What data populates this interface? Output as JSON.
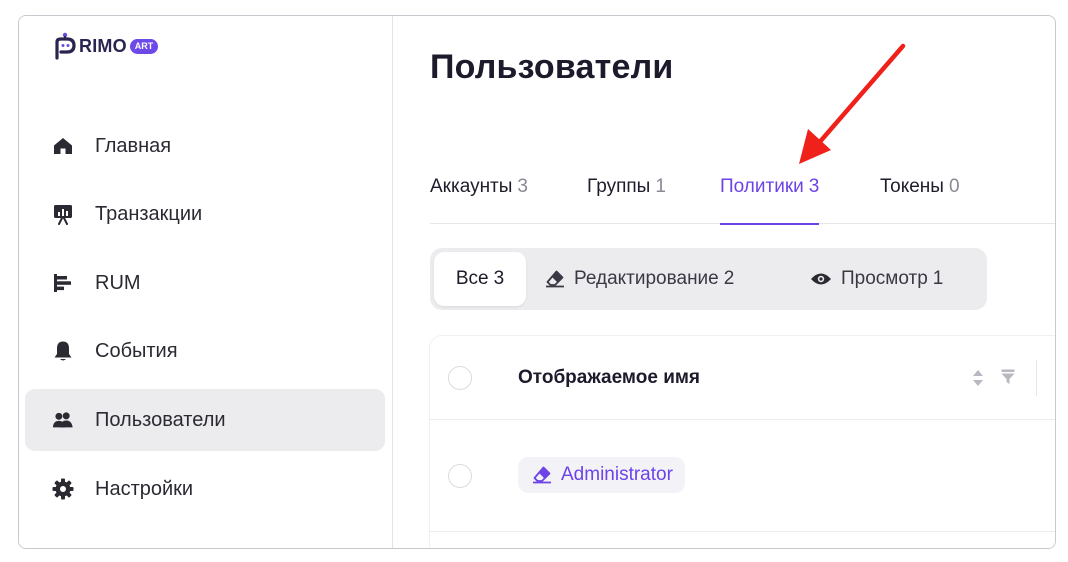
{
  "brand": {
    "logo_text": "RIMO",
    "logo_badge": "ART",
    "accent": "#6c43e6"
  },
  "sidebar": {
    "items": [
      {
        "label": "Главная",
        "icon": "home-icon"
      },
      {
        "label": "Транзакции",
        "icon": "presentation-icon"
      },
      {
        "label": "RUM",
        "icon": "bar-chart-icon"
      },
      {
        "label": "События",
        "icon": "bell-icon"
      },
      {
        "label": "Пользователи",
        "icon": "users-icon",
        "active": true
      },
      {
        "label": "Настройки",
        "icon": "gear-icon"
      }
    ]
  },
  "main": {
    "title": "Пользователи",
    "tabs": [
      {
        "label": "Аккаунты",
        "count": "3"
      },
      {
        "label": "Группы",
        "count": "1"
      },
      {
        "label": "Политики",
        "count": "3",
        "active": true
      },
      {
        "label": "Токены",
        "count": "0"
      }
    ],
    "filters": [
      {
        "label": "Все",
        "count": "3",
        "active": true
      },
      {
        "label": "Редактирование",
        "count": "2",
        "icon": "eraser-icon"
      },
      {
        "label": "Просмотр",
        "count": "1",
        "icon": "eye-icon"
      }
    ],
    "table": {
      "column_name": "Отображаемое имя",
      "rows": [
        {
          "name": "Administrator",
          "icon": "eraser-icon"
        }
      ]
    }
  },
  "annotation": {
    "color": "#f0201a"
  }
}
